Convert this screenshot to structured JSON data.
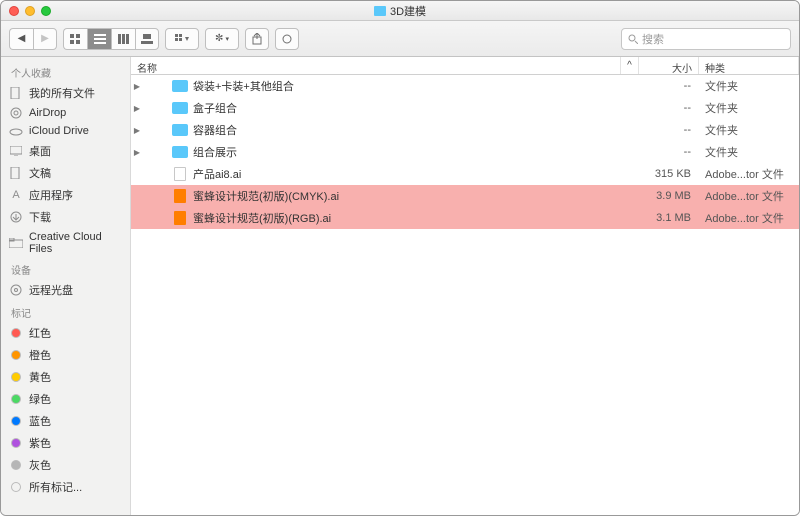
{
  "window": {
    "title": "3D建模"
  },
  "toolbar": {
    "search_placeholder": "搜索"
  },
  "sidebar": {
    "groups": [
      {
        "label": "个人收藏",
        "items": [
          {
            "icon": "doc",
            "label": "我的所有文件"
          },
          {
            "icon": "airdrop",
            "label": "AirDrop"
          },
          {
            "icon": "cloud",
            "label": "iCloud Drive"
          },
          {
            "icon": "desktop",
            "label": "桌面"
          },
          {
            "icon": "doc",
            "label": "文稿"
          },
          {
            "icon": "app",
            "label": "应用程序"
          },
          {
            "icon": "download",
            "label": "下载"
          },
          {
            "icon": "folder",
            "label": "Creative Cloud Files"
          }
        ]
      },
      {
        "label": "设备",
        "items": [
          {
            "icon": "disc",
            "label": "远程光盘"
          }
        ]
      },
      {
        "label": "标记",
        "items": [
          {
            "color": "#ff5a52",
            "label": "红色"
          },
          {
            "color": "#ff9500",
            "label": "橙色"
          },
          {
            "color": "#ffcc00",
            "label": "黄色"
          },
          {
            "color": "#4cd964",
            "label": "绿色"
          },
          {
            "color": "#007aff",
            "label": "蓝色"
          },
          {
            "color": "#af52de",
            "label": "紫色"
          },
          {
            "color": "#b6b6b6",
            "label": "灰色"
          },
          {
            "color": "",
            "label": "所有标记..."
          }
        ]
      }
    ]
  },
  "columns": {
    "name": "名称",
    "size": "大小",
    "kind": "种类"
  },
  "rows": [
    {
      "expandable": true,
      "type": "folder",
      "name": "袋装+卡装+其他组合",
      "size": "--",
      "kind": "文件夹"
    },
    {
      "expandable": true,
      "type": "folder",
      "name": "盒子组合",
      "size": "--",
      "kind": "文件夹"
    },
    {
      "expandable": true,
      "type": "folder",
      "name": "容器组合",
      "size": "--",
      "kind": "文件夹"
    },
    {
      "expandable": true,
      "type": "folder",
      "name": "组合展示",
      "size": "--",
      "kind": "文件夹"
    },
    {
      "expandable": false,
      "type": "file",
      "name": "产品ai8.ai",
      "size": "315 KB",
      "kind": "Adobe...tor 文件"
    },
    {
      "expandable": false,
      "type": "ai",
      "selected": true,
      "name": "蜜蜂设计规范(初版)(CMYK).ai",
      "size": "3.9 MB",
      "kind": "Adobe...tor 文件"
    },
    {
      "expandable": false,
      "type": "ai",
      "selected": true,
      "name": "蜜蜂设计规范(初版)(RGB).ai",
      "size": "3.1 MB",
      "kind": "Adobe...tor 文件"
    }
  ]
}
